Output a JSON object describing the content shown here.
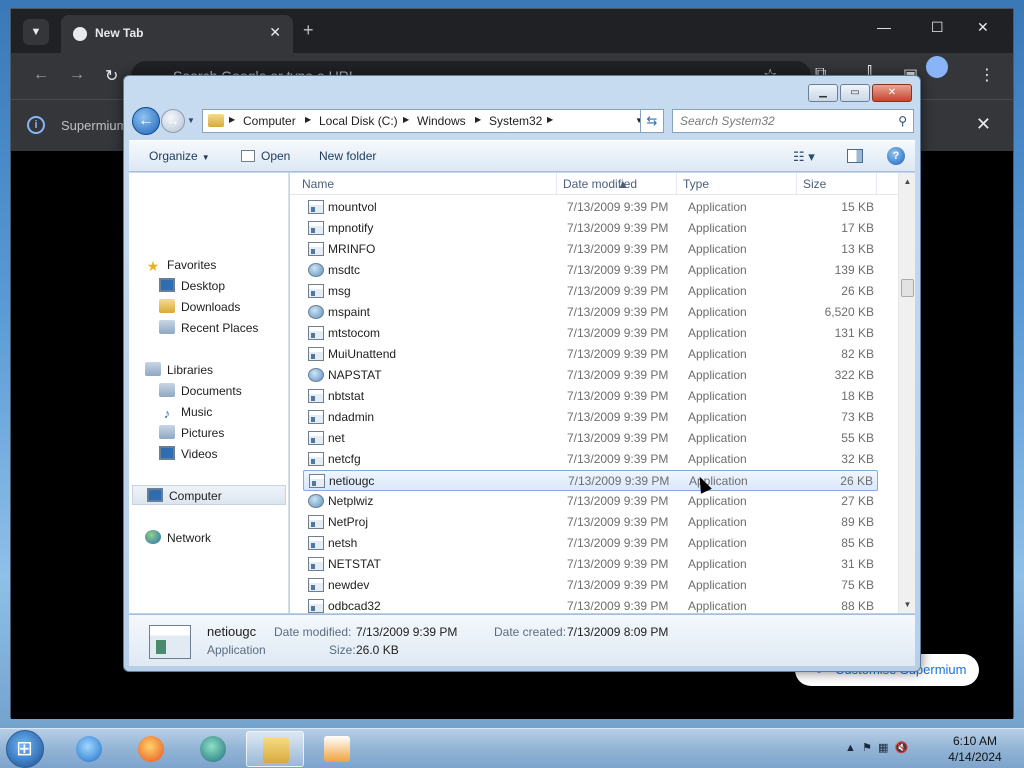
{
  "browser": {
    "tab_title": "New Tab",
    "omnibox_placeholder": "Search Google or type a URL",
    "infobar_text": "Supermium",
    "customise_label": "Customise Supermium"
  },
  "explorer": {
    "breadcrumb": [
      "Computer",
      "Local Disk (C:)",
      "Windows",
      "System32"
    ],
    "search_placeholder": "Search System32",
    "commands": {
      "organize": "Organize",
      "open": "Open",
      "new_folder": "New folder"
    },
    "nav": {
      "favorites": "Favorites",
      "favorites_items": [
        "Desktop",
        "Downloads",
        "Recent Places"
      ],
      "libraries": "Libraries",
      "libraries_items": [
        "Documents",
        "Music",
        "Pictures",
        "Videos"
      ],
      "computer": "Computer",
      "network": "Network"
    },
    "columns": {
      "name": "Name",
      "date": "Date modified",
      "type": "Type",
      "size": "Size"
    },
    "files": [
      {
        "name": "mountvol",
        "date": "7/13/2009 9:39 PM",
        "type": "Application",
        "size": "15 KB"
      },
      {
        "name": "mpnotify",
        "date": "7/13/2009 9:39 PM",
        "type": "Application",
        "size": "17 KB"
      },
      {
        "name": "MRINFO",
        "date": "7/13/2009 9:39 PM",
        "type": "Application",
        "size": "13 KB"
      },
      {
        "name": "msdtc",
        "date": "7/13/2009 9:39 PM",
        "type": "Application",
        "size": "139 KB"
      },
      {
        "name": "msg",
        "date": "7/13/2009 9:39 PM",
        "type": "Application",
        "size": "26 KB"
      },
      {
        "name": "mspaint",
        "date": "7/13/2009 9:39 PM",
        "type": "Application",
        "size": "6,520 KB"
      },
      {
        "name": "mtstocom",
        "date": "7/13/2009 9:39 PM",
        "type": "Application",
        "size": "131 KB"
      },
      {
        "name": "MuiUnattend",
        "date": "7/13/2009 9:39 PM",
        "type": "Application",
        "size": "82 KB"
      },
      {
        "name": "NAPSTAT",
        "date": "7/13/2009 9:39 PM",
        "type": "Application",
        "size": "322 KB"
      },
      {
        "name": "nbtstat",
        "date": "7/13/2009 9:39 PM",
        "type": "Application",
        "size": "18 KB"
      },
      {
        "name": "ndadmin",
        "date": "7/13/2009 9:39 PM",
        "type": "Application",
        "size": "73 KB"
      },
      {
        "name": "net",
        "date": "7/13/2009 9:39 PM",
        "type": "Application",
        "size": "55 KB"
      },
      {
        "name": "netcfg",
        "date": "7/13/2009 9:39 PM",
        "type": "Application",
        "size": "32 KB"
      },
      {
        "name": "netiougc",
        "date": "7/13/2009 9:39 PM",
        "type": "Application",
        "size": "26 KB",
        "selected": true
      },
      {
        "name": "Netplwiz",
        "date": "7/13/2009 9:39 PM",
        "type": "Application",
        "size": "27 KB"
      },
      {
        "name": "NetProj",
        "date": "7/13/2009 9:39 PM",
        "type": "Application",
        "size": "89 KB"
      },
      {
        "name": "netsh",
        "date": "7/13/2009 9:39 PM",
        "type": "Application",
        "size": "85 KB"
      },
      {
        "name": "NETSTAT",
        "date": "7/13/2009 9:39 PM",
        "type": "Application",
        "size": "31 KB"
      },
      {
        "name": "newdev",
        "date": "7/13/2009 9:39 PM",
        "type": "Application",
        "size": "75 KB"
      },
      {
        "name": "odbcad32",
        "date": "7/13/2009 9:39 PM",
        "type": "Application",
        "size": "88 KB"
      }
    ],
    "details": {
      "name": "netiougc",
      "kind": "Application",
      "date_modified_label": "Date modified:",
      "date_modified": "7/13/2009 9:39 PM",
      "date_created_label": "Date created:",
      "date_created": "7/13/2009 8:09 PM",
      "size_label": "Size:",
      "size": "26.0 KB"
    }
  },
  "taskbar": {
    "time": "6:10 AM",
    "date": "4/14/2024"
  }
}
